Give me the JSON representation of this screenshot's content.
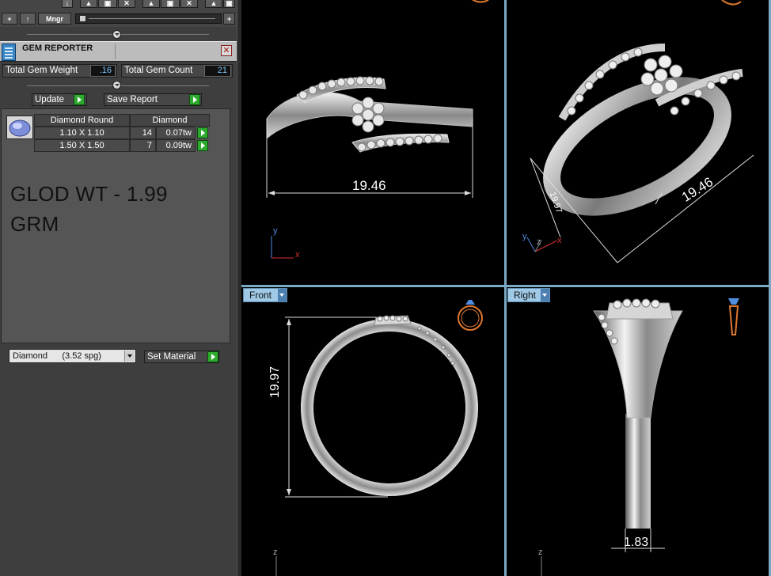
{
  "toolbar": {
    "add_label": "+",
    "up_label": "↑",
    "manager_label": "Mngr",
    "plus_right_label": "+"
  },
  "gem_reporter": {
    "title": "GEM REPORTER",
    "close_glyph": "✕",
    "total_weight_label": "Total Gem Weight",
    "total_weight_value": ".16",
    "total_count_label": "Total Gem Count",
    "total_count_value": "21",
    "update_label": "Update",
    "save_report_label": "Save Report",
    "table": {
      "headers": [
        "Diamond Round",
        "Diamond"
      ],
      "rows": [
        {
          "size": "1.10 X 1.10",
          "count": "14",
          "weight": "0.07tw"
        },
        {
          "size": "1.50 X 1.50",
          "count": "7",
          "weight": "0.09tw"
        }
      ]
    },
    "gold_note_line1": "GLOD WT - 1.99",
    "gold_note_line2": "GRM",
    "material_value": "Diamond      (3.52 spg)",
    "set_material_label": "Set Material"
  },
  "viewports": {
    "top_left": {
      "dimension_label": "19.46",
      "axis_y": "y",
      "axis_x": "x"
    },
    "top_right": {
      "dimension_label_main": "19.46",
      "dimension_label_side": "19.97",
      "axis_y": "y",
      "axis_x": "x",
      "axis_z": "z"
    },
    "bottom_left": {
      "tab_label": "Front",
      "dimension_label": "19.97",
      "axis_z": "z"
    },
    "bottom_right": {
      "tab_label": "Right",
      "dimension_label": "1.83",
      "axis_z": "z"
    }
  },
  "colors": {
    "accent_blue": "#7aa9c4",
    "play_green": "#2eab2e",
    "value_blue": "#7fc8ff",
    "metal_ring": "#c9c9c9",
    "orange_icon": "#e0782e"
  }
}
